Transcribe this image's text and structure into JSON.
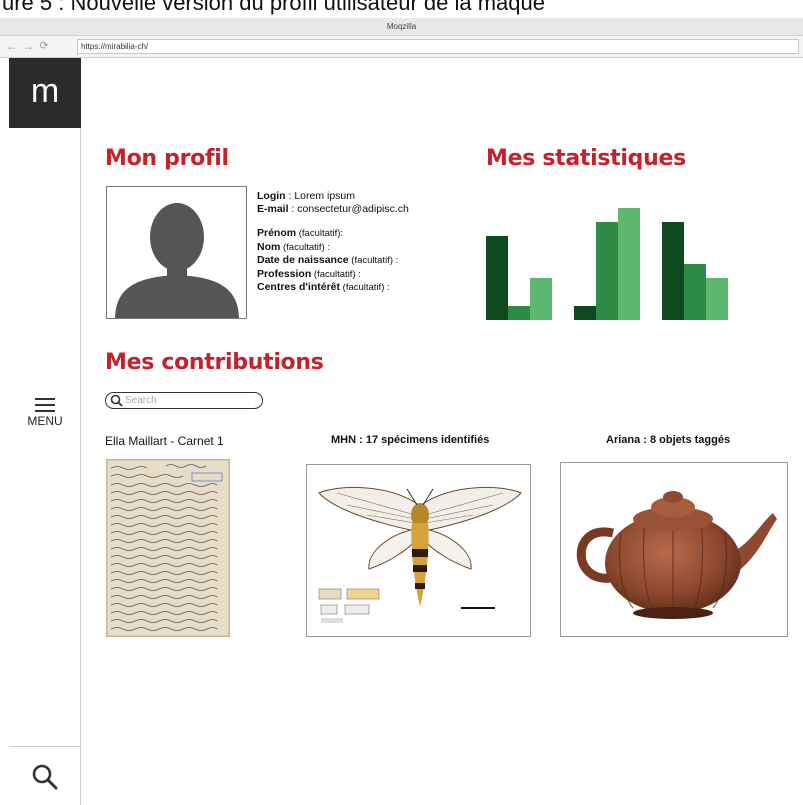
{
  "caption": "ure 5 : Nouvelle version du profil utilisateur de la maque",
  "window": {
    "title": "Moqzilla"
  },
  "navbar": {
    "back_icon": "arrow-left-icon",
    "forward_icon": "arrow-right-icon",
    "reload_icon": "reload-icon",
    "back_glyph": "←",
    "forward_glyph": "→",
    "reload_glyph": "⟳",
    "url": "https://mirabilia-ch/"
  },
  "sidebar": {
    "logo": "m",
    "menu_label": "MENU",
    "search_icon": "search-icon"
  },
  "profile": {
    "heading": "Mon profil",
    "login_label": "Login",
    "login_value": " : Lorem ipsum",
    "email_label": "E-mail",
    "email_value": " : consectetur@adipisc.ch",
    "fields": [
      {
        "label": "Prénom",
        "suffix": " (facultatif):"
      },
      {
        "label": "Nom",
        "suffix": " (facultatif) :"
      },
      {
        "label": "Date de naissance",
        "suffix": " (facultatif) :"
      },
      {
        "label": "Profession",
        "suffix": " (facultatif) :"
      },
      {
        "label": "Centres d'intérêt",
        "suffix": " (facultatif) :"
      }
    ]
  },
  "stats": {
    "heading": "Mes statistiques",
    "colors": [
      "#0d4a1f",
      "#2e8b45",
      "#5cb86e"
    ],
    "groups": [
      {
        "values": [
          0.6,
          0.1,
          0.3
        ]
      },
      {
        "values": [
          0.1,
          0.7,
          0.8
        ]
      },
      {
        "values": [
          0.7,
          0.4,
          0.3
        ]
      }
    ]
  },
  "contributions": {
    "heading": "Mes contributions",
    "search_placeholder": "Search",
    "items": [
      {
        "title": "Ella Maillart - Carnet 1",
        "image": "handwritten-notebook-page"
      },
      {
        "title": "MHN : 17 spécimens identifiés",
        "image": "moth-specimen"
      },
      {
        "title": "Ariana : 8 objets taggés",
        "image": "clay-teapot"
      }
    ]
  }
}
